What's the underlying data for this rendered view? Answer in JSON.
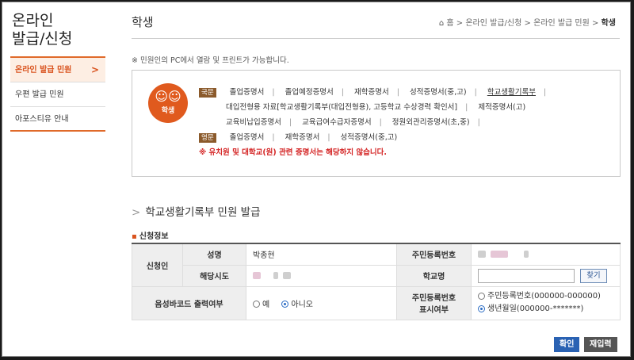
{
  "sidebar": {
    "title_line1": "온라인",
    "title_line2": "발급/신청",
    "items": [
      {
        "label": "온라인 발급 민원",
        "chev": ">"
      },
      {
        "label": "우편 발급 민원"
      },
      {
        "label": "아포스티유 안내"
      }
    ]
  },
  "header": {
    "title": "학생",
    "breadcrumb": {
      "home_icon": "⌂",
      "home": "홈",
      "sep": ">",
      "b1": "온라인 발급/신청",
      "b2": "온라인 발급 민원",
      "current": "학생"
    }
  },
  "notice": "※ 민원인의 PC에서 열람 및 프린트가 가능합니다.",
  "certs": {
    "icon_label": "학생",
    "icon_name": "students-icon",
    "tag_kr": "국문",
    "tag_en": "영문",
    "sep": "|",
    "kr": {
      "c1": "졸업증명서",
      "c2": "졸업예정증명서",
      "c3": "재학증명서",
      "c4": "성적증명서(중,고)",
      "c5": "학교생활기록부",
      "c6": "대입전형용 자료[학교생활기록부(대입전형용), 고등학교 수상경력 확인서]",
      "c7": "제적증명서(고)",
      "c8": "교육비납입증명서",
      "c9": "교육급여수급자증명서",
      "c10": "정원외관리증명서(초,중)"
    },
    "en": {
      "c1": "졸업증명서",
      "c2": "재학증명서",
      "c3": "성적증명서(중,고)"
    },
    "warning": "※ 유치원 및 대학교(원) 관련 증명서는 해당하지 않습니다."
  },
  "section": {
    "arrow": ">",
    "title": "학교생활기록부 민원 발급",
    "sub_dot": "▪",
    "sub": "신청정보"
  },
  "form": {
    "applicant": "신청인",
    "name_label": "성명",
    "name_value": "박종현",
    "rrn_label": "주민등록번호",
    "region_label": "해당시도",
    "school_label": "학교명",
    "school_value": "",
    "find_btn": "찾기",
    "barcode_label": "음성바코드 출력여부",
    "barcode_yes": "예",
    "barcode_no": "아니오",
    "barcode_selected": "아니오",
    "rrn_display_label1": "주민등록번호",
    "rrn_display_label2": "표시여부",
    "rrn_opt1": "주민등록번호(000000-000000)",
    "rrn_opt2": "생년월일(000000-*******)",
    "rrn_selected": "생년월일(000000-*******)"
  },
  "buttons": {
    "ok": "확인",
    "reset": "재입력"
  },
  "colors": {
    "accent": "#e05a1e",
    "primary_button": "#2a62b3",
    "warning": "#d42424",
    "tag": "#8b5a2b"
  }
}
